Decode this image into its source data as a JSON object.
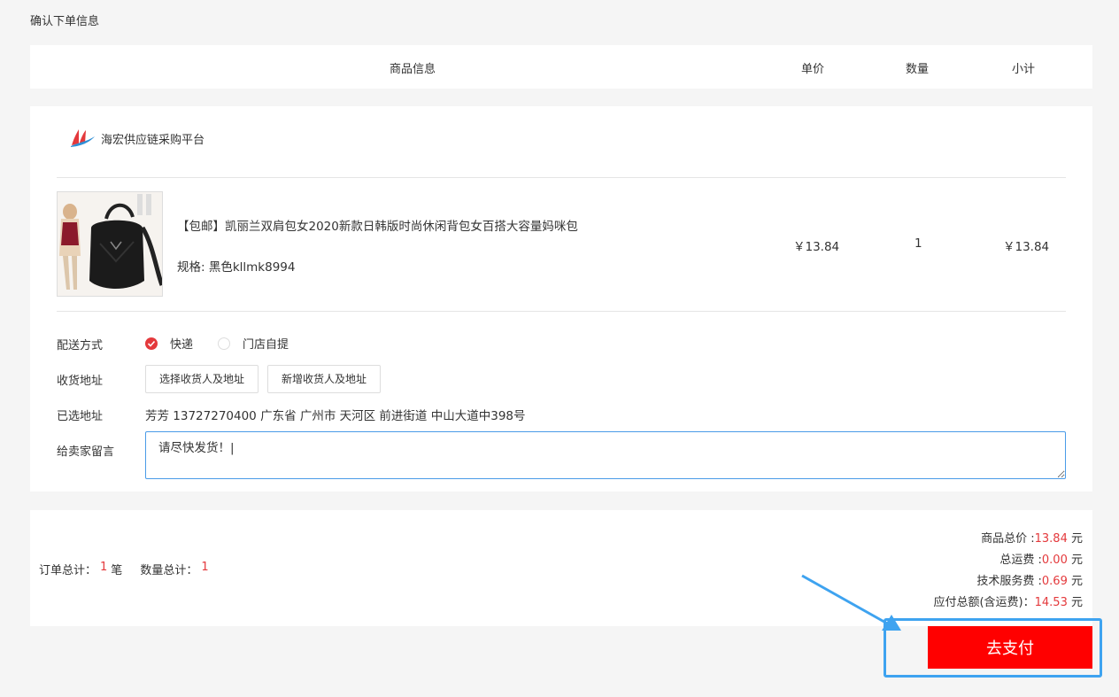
{
  "page": {
    "title": "确认下单信息"
  },
  "header": {
    "info": "商品信息",
    "price": "单价",
    "qty": "数量",
    "subtotal": "小计"
  },
  "store": {
    "name": "海宏供应链采购平台",
    "logo_icon": "store-logo-icon"
  },
  "product": {
    "name": "【包邮】凯丽兰双肩包女2020新款日韩版时尚休闲背包女百搭大容量妈咪包",
    "spec": "规格: 黑色kllmk8994",
    "price": "￥13.84",
    "qty": "1",
    "subtotal": "￥13.84"
  },
  "form": {
    "shipping_label": "配送方式",
    "shipping_options": [
      "快递",
      "门店自提"
    ],
    "address_label": "收货地址",
    "choose_address": "选择收货人及地址",
    "new_address": "新增收货人及地址",
    "selected_label": "已选地址",
    "selected_address": "芳芳 13727270400 广东省 广州市 天河区 前进街道 中山大道中398号",
    "message_label": "给卖家留言",
    "message_value": "请尽快发货！|"
  },
  "summary": {
    "order_total_label": "订单总计：",
    "order_total_value": "1",
    "order_unit": "笔",
    "qty_total_label": "数量总计：",
    "qty_total_value": "1",
    "goods_label": "商品总价 :",
    "goods_value": "13.84",
    "shipping_label": "总运费 :",
    "shipping_value": "0.00",
    "service_label": "技术服务费 :",
    "service_value": "0.69",
    "due_label": "应付总额(含运费)：",
    "due_value": "14.53",
    "currency": "元"
  },
  "pay_button": "去支付",
  "colors": {
    "accent_red": "#e4393c",
    "pay_red": "#ff0000",
    "highlight_blue": "#3ea3f0"
  }
}
